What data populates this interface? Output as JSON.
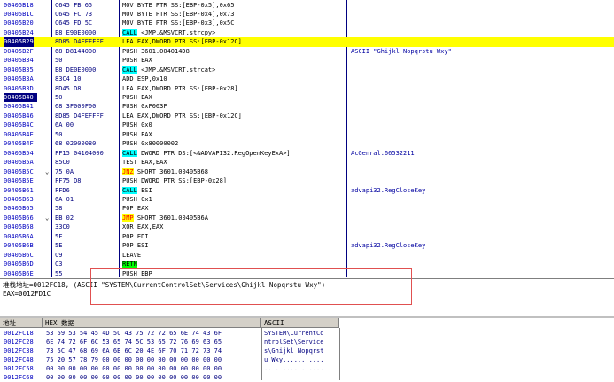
{
  "disasm": [
    {
      "addr": "00405B18",
      "hex": "C645 FB 65",
      "tick": "",
      "ins_pre": "MOV BYTE PTR SS:[EBP-0x5],0x65",
      "kw": "",
      "ins_post": "",
      "comment": ""
    },
    {
      "addr": "00405B1C",
      "hex": "C645 FC 73",
      "tick": "",
      "ins_pre": "MOV BYTE PTR SS:[EBP-0x4],0x73",
      "kw": "",
      "ins_post": "",
      "comment": ""
    },
    {
      "addr": "00405B20",
      "hex": "C645 FD 5C",
      "tick": "",
      "ins_pre": "MOV BYTE PTR SS:[EBP-0x3],0x5C",
      "kw": "",
      "ins_post": "",
      "comment": ""
    },
    {
      "addr": "00405B24",
      "hex": "E8 E90E0000",
      "tick": "",
      "ins_pre": "",
      "kw": "CALL",
      "kwtype": "call",
      "ins_post": " <JMP.&MSVCRT.strcpy>",
      "comment": ""
    },
    {
      "addr": "00405B29",
      "hex": "8D85 D4FEFFFF",
      "tick": "",
      "ins_pre": "LEA EAX,DWORD PTR SS:[EBP-0x12C]",
      "kw": "",
      "ins_post": "",
      "comment": "",
      "state": "cur"
    },
    {
      "addr": "00405B2F",
      "hex": "68 D8144000",
      "tick": "",
      "ins_pre": "PUSH 3601.004014D8",
      "kw": "",
      "ins_post": "",
      "comment": "ASCII \"Ghijkl Nopqrstu Wxy\""
    },
    {
      "addr": "00405B34",
      "hex": "50",
      "tick": "",
      "ins_pre": "PUSH EAX",
      "kw": "",
      "ins_post": "",
      "comment": ""
    },
    {
      "addr": "00405B35",
      "hex": "E8 DE0E0000",
      "tick": "",
      "ins_pre": "",
      "kw": "CALL",
      "kwtype": "call",
      "ins_post": " <JMP.&MSVCRT.strcat>",
      "comment": ""
    },
    {
      "addr": "00405B3A",
      "hex": "83C4 10",
      "tick": "",
      "ins_pre": "ADD ESP,0x10",
      "kw": "",
      "ins_post": "",
      "comment": ""
    },
    {
      "addr": "00405B3D",
      "hex": "8D45 D8",
      "tick": "",
      "ins_pre": "LEA EAX,DWORD PTR SS:[EBP-0x28]",
      "kw": "",
      "ins_post": "",
      "comment": ""
    },
    {
      "addr": "00405B40",
      "hex": "50",
      "tick": "",
      "ins_pre": "PUSH EAX",
      "kw": "",
      "ins_post": "",
      "comment": "",
      "state": "sel"
    },
    {
      "addr": "00405B41",
      "hex": "68 3F000F00",
      "tick": "",
      "ins_pre": "PUSH 0xF003F",
      "kw": "",
      "ins_post": "",
      "comment": ""
    },
    {
      "addr": "00405B46",
      "hex": "8D85 D4FEFFFF",
      "tick": "",
      "ins_pre": "LEA EAX,DWORD PTR SS:[EBP-0x12C]",
      "kw": "",
      "ins_post": "",
      "comment": ""
    },
    {
      "addr": "00405B4C",
      "hex": "6A 00",
      "tick": "",
      "ins_pre": "PUSH 0x0",
      "kw": "",
      "ins_post": "",
      "comment": ""
    },
    {
      "addr": "00405B4E",
      "hex": "50",
      "tick": "",
      "ins_pre": "PUSH EAX",
      "kw": "",
      "ins_post": "",
      "comment": ""
    },
    {
      "addr": "00405B4F",
      "hex": "68 02000080",
      "tick": "",
      "ins_pre": "PUSH 0x80000002",
      "kw": "",
      "ins_post": "",
      "comment": ""
    },
    {
      "addr": "00405B54",
      "hex": "FF15 04104000",
      "tick": "",
      "ins_pre": "",
      "kw": "CALL",
      "kwtype": "call",
      "ins_post": " DWORD PTR DS:[<&ADVAPI32.RegOpenKeyExA>]",
      "comment": "AcGenral.66532211"
    },
    {
      "addr": "00405B5A",
      "hex": "85C0",
      "tick": "",
      "ins_pre": "TEST EAX,EAX",
      "kw": "",
      "ins_post": "",
      "comment": ""
    },
    {
      "addr": "00405B5C",
      "hex": "75 0A",
      "tick": "⌄",
      "ins_pre": "",
      "kw": "JNZ",
      "kwtype": "jmp",
      "ins_post": " SHORT 3601.00405B68",
      "comment": ""
    },
    {
      "addr": "00405B5E",
      "hex": "FF75 D8",
      "tick": "",
      "ins_pre": "PUSH DWORD PTR SS:[EBP-0x28]",
      "kw": "",
      "ins_post": "",
      "comment": ""
    },
    {
      "addr": "00405B61",
      "hex": "FFD6",
      "tick": "",
      "ins_pre": "",
      "kw": "CALL",
      "kwtype": "call",
      "ins_post": " ESI",
      "comment": "advapi32.RegCloseKey"
    },
    {
      "addr": "00405B63",
      "hex": "6A 01",
      "tick": "",
      "ins_pre": "PUSH 0x1",
      "kw": "",
      "ins_post": "",
      "comment": ""
    },
    {
      "addr": "00405B65",
      "hex": "58",
      "tick": "",
      "ins_pre": "POP EAX",
      "kw": "",
      "ins_post": "",
      "comment": ""
    },
    {
      "addr": "00405B66",
      "hex": "EB 02",
      "tick": "⌄",
      "ins_pre": "",
      "kw": "JMP",
      "kwtype": "jmp",
      "ins_post": " SHORT 3601.00405B6A",
      "comment": ""
    },
    {
      "addr": "00405B68",
      "hex": "33C0",
      "tick": "",
      "ins_pre": "XOR EAX,EAX",
      "kw": "",
      "ins_post": "",
      "comment": ""
    },
    {
      "addr": "00405B6A",
      "hex": "5F",
      "tick": "",
      "ins_pre": "POP EDI",
      "kw": "",
      "ins_post": "",
      "comment": ""
    },
    {
      "addr": "00405B6B",
      "hex": "5E",
      "tick": "",
      "ins_pre": "POP ESI",
      "kw": "",
      "ins_post": "",
      "comment": "advapi32.RegCloseKey"
    },
    {
      "addr": "00405B6C",
      "hex": "C9",
      "tick": "",
      "ins_pre": "LEAVE",
      "kw": "",
      "ins_post": "",
      "comment": ""
    },
    {
      "addr": "00405B6D",
      "hex": "C3",
      "tick": "",
      "ins_pre": "",
      "kw": "RETN",
      "kwtype": "ret",
      "ins_post": "",
      "comment": ""
    },
    {
      "addr": "00405B6E",
      "hex": "55",
      "tick": "",
      "ins_pre": "PUSH EBP",
      "kw": "",
      "ins_post": "",
      "comment": ""
    }
  ],
  "info": {
    "line1": "堆栈地址=0012FC18, (ASCII \"SYSTEM\\CurrentControlSet\\Services\\Ghijkl Nopqrstu Wxy\")",
    "line2": "EAX=0012FD1C"
  },
  "dump": {
    "col_addr": "地址",
    "col_hex": "HEX 数据",
    "col_ascii": "ASCII",
    "rows": [
      {
        "addr": "0012FC18",
        "hex": "53 59 53 54 45 4D 5C 43 75 72 72 65 6E 74 43 6F",
        "ascii": "SYSTEM\\CurrentCo"
      },
      {
        "addr": "0012FC28",
        "hex": "6E 74 72 6F 6C 53 65 74 5C 53 65 72 76 69 63 65",
        "ascii": "ntrolSet\\Service"
      },
      {
        "addr": "0012FC38",
        "hex": "73 5C 47 68 69 6A 6B 6C 20 4E 6F 70 71 72 73 74",
        "ascii": "s\\Ghijkl Nopqrst"
      },
      {
        "addr": "0012FC48",
        "hex": "75 20 57 78 79 00 00 00 00 00 00 00 00 00 00 00",
        "ascii": "u Wxy..........."
      },
      {
        "addr": "0012FC58",
        "hex": "00 00 00 00 00 00 00 00 00 00 00 00 00 00 00 00",
        "ascii": "................"
      },
      {
        "addr": "0012FC68",
        "hex": "00 00 00 00 00 00 00 00 00 00 00 00 00 00 00 00",
        "ascii": ""
      }
    ]
  }
}
